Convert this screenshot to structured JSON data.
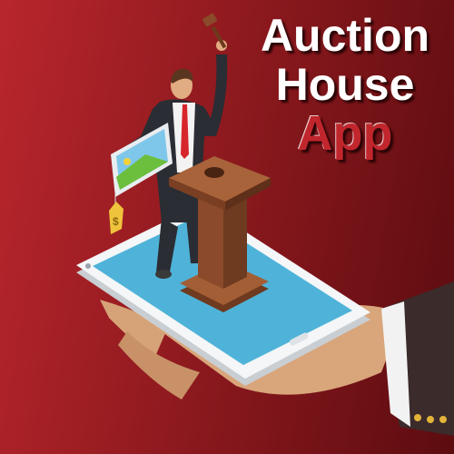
{
  "title": {
    "line1": "Auction",
    "line2": "House",
    "line3": "App"
  },
  "illustration": {
    "icons": [
      "gavel-icon",
      "painting-icon",
      "price-tag-icon",
      "podium-icon",
      "smartphone-icon",
      "hand-icon"
    ],
    "price_tag_symbol": "$"
  },
  "colors": {
    "background": "#a11f25",
    "accent_red": "#c1262c",
    "screen": "#4fb3d9",
    "podium": "#8b4a2b"
  }
}
